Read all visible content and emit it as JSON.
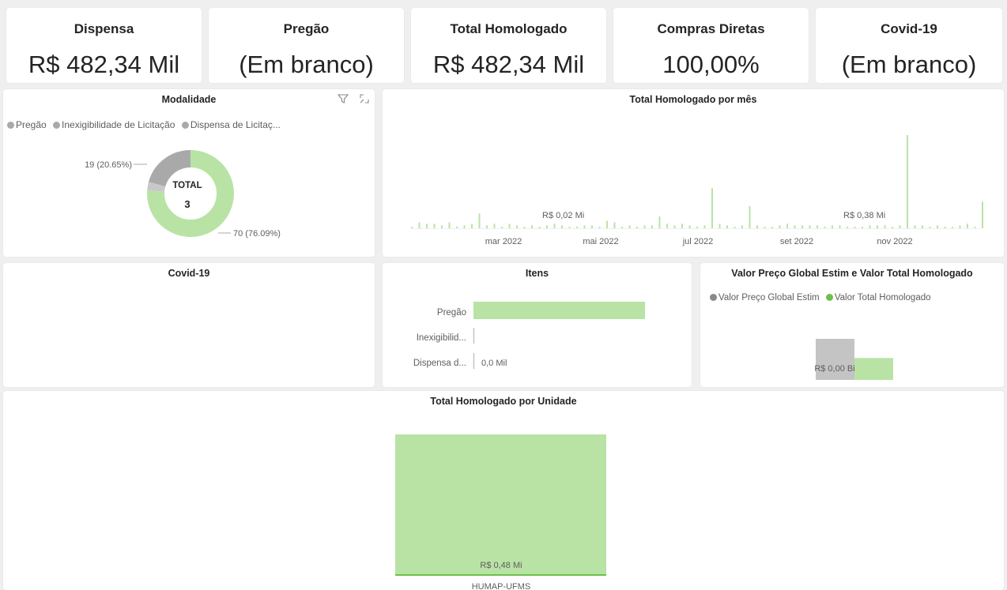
{
  "kpis": [
    {
      "title": "Dispensa",
      "value": "R$ 482,34 Mil"
    },
    {
      "title": "Pregão",
      "value": "(Em branco)"
    },
    {
      "title": "Total Homologado",
      "value": "R$ 482,34 Mil"
    },
    {
      "title": "Compras Diretas",
      "value": "100,00%"
    },
    {
      "title": "Covid-19",
      "value": "(Em branco)"
    }
  ],
  "modalidade": {
    "title": "Modalidade",
    "legend": [
      "Pregão",
      "Inexigibilidade de Licitação",
      "Dispensa de Licitaç..."
    ],
    "center_label": "TOTAL",
    "center_value": "3",
    "label_gray": "19 (20.65%)",
    "label_green": "70 (76.09%)",
    "icons": [
      "filter-icon",
      "focus-mode-icon"
    ]
  },
  "mensal": {
    "title": "Total Homologado por mês",
    "label_a": "R$ 0,02 Mi",
    "label_b": "R$ 0,38 Mi",
    "ticks": [
      "mar 2022",
      "mai 2022",
      "jul 2022",
      "set 2022",
      "nov 2022"
    ]
  },
  "covid": {
    "title": "Covid-19"
  },
  "itens": {
    "title": "Itens",
    "value_label": "0,0 Mil"
  },
  "valor": {
    "title": "Valor Preço Global Estim e Valor Total Homologado",
    "legend": [
      "Valor Preço Global Estim",
      "Valor Total Homologado"
    ],
    "label": "R$ 0,00 Bi"
  },
  "unidade": {
    "title": "Total Homologado por Unidade",
    "value_label": "R$ 0,48 Mi",
    "category": "HUMAP-UFMS"
  },
  "colors": {
    "green": "#b9e3a5",
    "green_dark": "#6cc04a",
    "gray": "#a9a9a9",
    "gray_light": "#c8c8c8"
  },
  "chart_data": [
    {
      "type": "pie",
      "title": "Modalidade",
      "categories": [
        "Pregão",
        "Inexigibilidade de Licitação",
        "Dispensa de Licitaç..."
      ],
      "values": [
        3,
        19,
        70
      ],
      "labels": [
        "",
        "19 (20.65%)",
        "70 (76.09%)"
      ]
    },
    {
      "type": "bar",
      "title": "Itens",
      "categories": [
        "Pregão",
        "Inexigibilid...",
        "Dispensa d..."
      ],
      "values": [
        100,
        0,
        0
      ],
      "data_labels": [
        "",
        "",
        "0,0 Mil"
      ]
    },
    {
      "type": "bar",
      "title": "Valor Preço Global Estim e Valor Total Homologado",
      "series": [
        {
          "name": "Valor Preço Global Estim",
          "values": [
            0.0009
          ]
        },
        {
          "name": "Valor Total Homologado",
          "values": [
            0.00048
          ]
        }
      ],
      "data_label": "R$ 0,00 Bi"
    },
    {
      "type": "bar",
      "title": "Total Homologado por Unidade",
      "categories": [
        "HUMAP-UFMS"
      ],
      "values": [
        0.48
      ],
      "data_labels": [
        "R$ 0,48 Mi"
      ]
    },
    {
      "type": "bar",
      "title": "Total Homologado por mês",
      "x_ticks": [
        "mar 2022",
        "mai 2022",
        "jul 2022",
        "set 2022",
        "nov 2022"
      ],
      "values": [
        0.1,
        0.4,
        0.3,
        0.3,
        0.2,
        0.4,
        0.1,
        0.2,
        0.3,
        1.0,
        0.2,
        0.3,
        0.1,
        0.3,
        0.2,
        0.1,
        0.2,
        0.1,
        0.2,
        0.3,
        0.2,
        0.1,
        0.1,
        0.2,
        0.2,
        0.1,
        0.5,
        0.4,
        0.1,
        0.2,
        0.1,
        0.2,
        0.2,
        0.8,
        0.3,
        0.2,
        0.3,
        0.2,
        0.1,
        0.2,
        2.7,
        0.3,
        0.2,
        0.1,
        0.2,
        1.5,
        0.2,
        0.1,
        0.1,
        0.2,
        0.3,
        0.2,
        0.2,
        0.2,
        0.2,
        0.1,
        0.2,
        0.2,
        0.1,
        0.1,
        0.1,
        0.2,
        0.2,
        0.2,
        0.1,
        0.2,
        6.3,
        0.2,
        0.2,
        0.1,
        0.2,
        0.1,
        0.1,
        0.2,
        0.3,
        0.1,
        1.8
      ],
      "data_labels": [
        "R$ 0,02 Mi",
        "R$ 0,38 Mi"
      ]
    }
  ]
}
